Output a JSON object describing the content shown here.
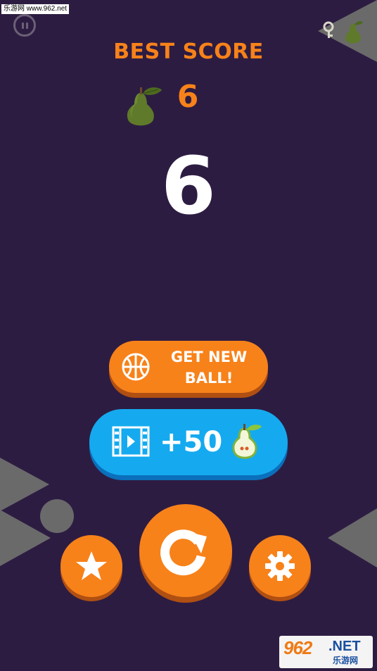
{
  "watermark_top": "乐游网 www.962.net",
  "hud": {
    "best_label": "BEST SCORE",
    "best_value": "6",
    "score": "6"
  },
  "buttons": {
    "new_ball_line1": "GET NEW",
    "new_ball_line2": "BALL!",
    "video_reward": "+50"
  },
  "icons": {
    "pause": "pause-icon",
    "key": "key-icon",
    "pear": "pear-icon",
    "basketball": "basketball-icon",
    "video": "video-film-icon",
    "star": "star-icon",
    "replay": "replay-icon",
    "gear": "gear-icon"
  },
  "colors": {
    "background": "#2d1c42",
    "orange": "#f7821a",
    "blue": "#15aaef",
    "pear_green": "#5f7a2a"
  },
  "watermark_bottom": {
    "number": "962",
    "domain": ".NET",
    "cn": "乐游网"
  }
}
